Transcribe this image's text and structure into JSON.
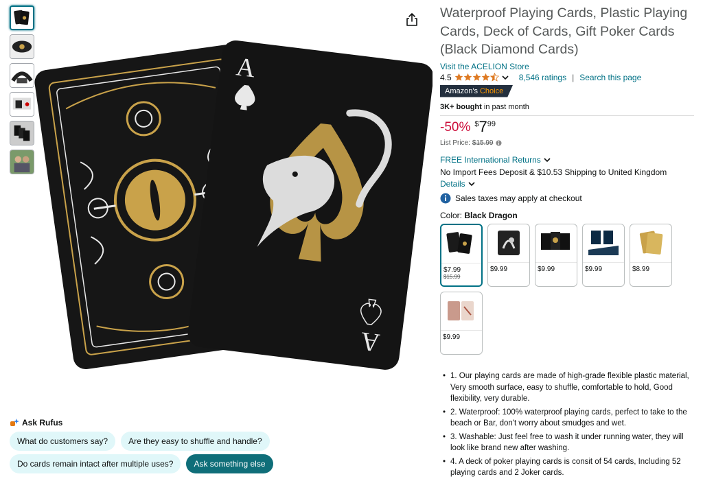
{
  "product": {
    "title": "Waterproof Playing Cards, Plastic Playing Cards, Deck of Cards, Gift Poker Cards (Black Diamond Cards)",
    "store_link": "Visit the ACELION Store",
    "rating": "4.5",
    "ratings_count": "8,546 ratings",
    "search_page": "Search this page",
    "separator": "|",
    "badge_prefix": "Amazon's",
    "badge_choice": "Choice",
    "bought_bold": "3K+ bought",
    "bought_rest": " in past month",
    "discount": "-50%",
    "price_symbol": "$",
    "price_whole": "7",
    "price_fraction": "99",
    "list_price_label": "List Price:",
    "list_price_value": "$15.99",
    "returns": "FREE International Returns",
    "shipping": "No Import Fees Deposit & $10.53 Shipping to United Kingdom",
    "details": "Details",
    "tax": "Sales taxes may apply at checkout",
    "color_label": "Color: ",
    "color_value": "Black Dragon"
  },
  "swatches": [
    {
      "price": "$7.99",
      "list": "$15.99",
      "selected": true,
      "theme": "black"
    },
    {
      "price": "$9.99",
      "list": "",
      "selected": false,
      "theme": "dragon"
    },
    {
      "price": "$9.99",
      "list": "",
      "selected": false,
      "theme": "gold"
    },
    {
      "price": "$9.99",
      "list": "",
      "selected": false,
      "theme": "blue"
    },
    {
      "price": "$8.99",
      "list": "",
      "selected": false,
      "theme": "goldfoil"
    },
    {
      "price": "$9.99",
      "list": "",
      "selected": false,
      "theme": "rose"
    }
  ],
  "bullets": [
    "1. Our playing cards are made of high-grade flexible plastic material, Very smooth surface, easy to shuffle, comfortable to hold, Good flexibility, very durable.",
    "2. Waterproof: 100% waterproof playing cards, perfect to take to the beach or Bar, don't worry about smudges and wet.",
    "3. Washable: Just feel free to wash it under running water, they will look like brand new after washing.",
    "4. A deck of poker playing cards is consit of 54 cards, Including 52 playing cards and 2 Joker cards."
  ],
  "rufus": {
    "title": "Ask Rufus",
    "chips": [
      "What do customers say?",
      "Are they easy to shuffle and handle?",
      "Do cards remain intact after multiple uses?",
      "Ask something else"
    ]
  },
  "card": {
    "rank": "A"
  },
  "colors": {
    "link": "#007185",
    "deal": "#cc0c39",
    "badge_bg": "#232f3e",
    "badge_accent": "#ff9900",
    "star": "#de7921",
    "chip_bg": "#e0f7f9",
    "chip_dark": "#0f6e79"
  },
  "icons": {
    "share": "share-icon",
    "star": "star-icon",
    "info": "info-icon",
    "chevron": "chevron-down-icon",
    "rufus": "rufus-spark-icon"
  }
}
